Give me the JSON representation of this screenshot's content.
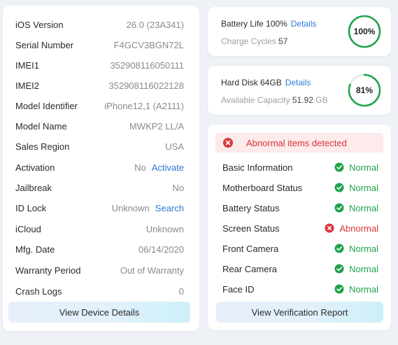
{
  "device_info": [
    {
      "label": "iOS Version",
      "value": "26.0 (23A341)"
    },
    {
      "label": "Serial Number",
      "value": "F4GCV3BGN72L"
    },
    {
      "label": "IMEI1",
      "value": "352908116050111"
    },
    {
      "label": "IMEI2",
      "value": "352908116022128"
    },
    {
      "label": "Model Identifier",
      "value": "iPhone12,1 (A2111)"
    },
    {
      "label": "Model Name",
      "value": "MWKP2 LL/A"
    },
    {
      "label": "Sales Region",
      "value": "USA"
    },
    {
      "label": "Activation",
      "value": "No",
      "link": "Activate"
    },
    {
      "label": "Jailbreak",
      "value": "No"
    },
    {
      "label": "ID Lock",
      "value": "Unknown",
      "link": "Search"
    },
    {
      "label": "iCloud",
      "value": "Unknown"
    },
    {
      "label": "Mfg. Date",
      "value": "06/14/2020"
    },
    {
      "label": "Warranty Period",
      "value": "Out of Warranty"
    },
    {
      "label": "Crash Logs",
      "value": "0"
    }
  ],
  "view_device_details": "View Device Details",
  "battery": {
    "title": "Battery Life 100%",
    "details_link": "Details",
    "sub_label": "Charge Cycles",
    "sub_value": "57",
    "ring_text": "100%",
    "ring_fraction": 1.0
  },
  "disk": {
    "title": "Hard Disk 64GB",
    "details_link": "Details",
    "sub_label": "Available Capacity",
    "sub_value": "51.92",
    "sub_unit": "GB",
    "ring_text": "81%",
    "ring_fraction": 0.81
  },
  "alert": {
    "text": "Abnormal items detected",
    "icon": "error-x-icon"
  },
  "checks": [
    {
      "label": "Basic Information",
      "status": "Normal",
      "ok": true
    },
    {
      "label": "Motherboard Status",
      "status": "Normal",
      "ok": true
    },
    {
      "label": "Battery Status",
      "status": "Normal",
      "ok": true
    },
    {
      "label": "Screen Status",
      "status": "Abnormal",
      "ok": false
    },
    {
      "label": "Front Camera",
      "status": "Normal",
      "ok": true
    },
    {
      "label": "Rear Camera",
      "status": "Normal",
      "ok": true
    },
    {
      "label": "Face ID",
      "status": "Normal",
      "ok": true
    }
  ],
  "view_verification_report": "View Verification Report",
  "colors": {
    "ok": "#1ea34a",
    "error": "#d8363a",
    "link": "#2d7ad6",
    "ring_track": "#e6e6e6"
  }
}
